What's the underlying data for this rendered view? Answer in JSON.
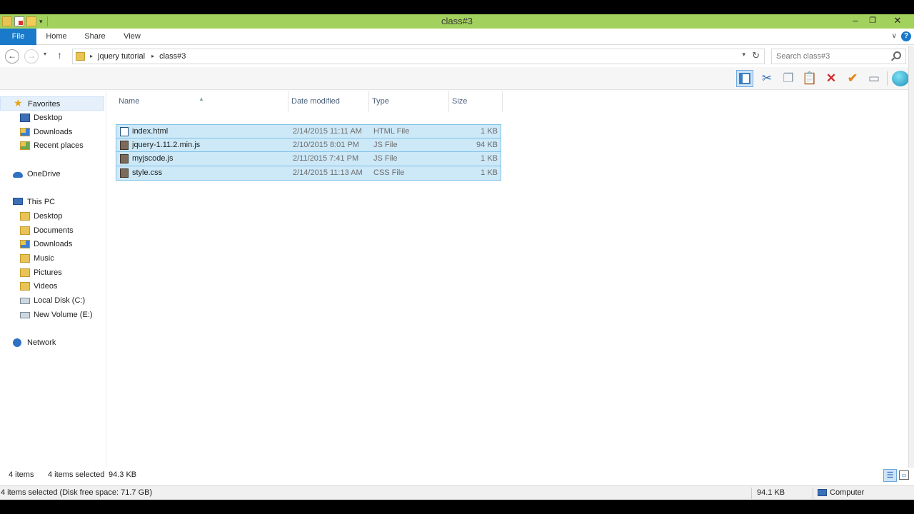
{
  "window": {
    "title": "class#3",
    "buttons": {
      "minimize": "–",
      "restore": "❐",
      "close": "✕"
    }
  },
  "ribbon": {
    "tabs": [
      "File",
      "Home",
      "Share",
      "View"
    ],
    "expand": "∨",
    "help": "?"
  },
  "nav": {
    "back": "←",
    "forward": "→",
    "recent": "▾",
    "up": "↑",
    "breadcrumb": [
      "jquery tutorial",
      "class#3"
    ],
    "refresh": "↻",
    "search_placeholder": "Search class#3"
  },
  "toolbar": {
    "icons": [
      "preview-pane-icon",
      "cut-icon",
      "copy-icon",
      "paste-icon",
      "delete-icon",
      "checkmark-icon",
      "rename-icon",
      "globe-icon"
    ],
    "cut": "✂",
    "copy": "❐",
    "paste": "📋",
    "delete": "✕",
    "check": "✔",
    "rename": "▭"
  },
  "sidebar": {
    "favorites": {
      "label": "Favorites",
      "items": [
        "Desktop",
        "Downloads",
        "Recent places"
      ]
    },
    "onedrive": "OneDrive",
    "thispc": {
      "label": "This PC",
      "items": [
        "Desktop",
        "Documents",
        "Downloads",
        "Music",
        "Pictures",
        "Videos",
        "Local Disk (C:)",
        "New Volume (E:)"
      ]
    },
    "network": "Network"
  },
  "columns": {
    "name": "Name",
    "date": "Date modified",
    "type": "Type",
    "size": "Size"
  },
  "files": [
    {
      "name": "index.html",
      "date": "2/14/2015 11:11 AM",
      "type": "HTML File",
      "size": "1 KB",
      "selected": true
    },
    {
      "name": "jquery-1.11.2.min.js",
      "date": "2/10/2015 8:01 PM",
      "type": "JS File",
      "size": "94 KB",
      "selected": true
    },
    {
      "name": "myjscode.js",
      "date": "2/11/2015 7:41 PM",
      "type": "JS File",
      "size": "1 KB",
      "selected": true
    },
    {
      "name": "style.css",
      "date": "2/14/2015 11:13 AM",
      "type": "CSS File",
      "size": "1 KB",
      "selected": true
    }
  ],
  "status": {
    "count": "4 items",
    "selected": "4 items selected",
    "selected_size": "94.3 KB",
    "free_space": "4 items selected (Disk free space: 71.7 GB)",
    "size": "94.1 KB",
    "location": "Computer"
  },
  "colors": {
    "titlebar": "#a3d15e",
    "file_tab": "#1979ca",
    "selection": "#cde8f7",
    "selection_border": "#7fc2e7"
  }
}
